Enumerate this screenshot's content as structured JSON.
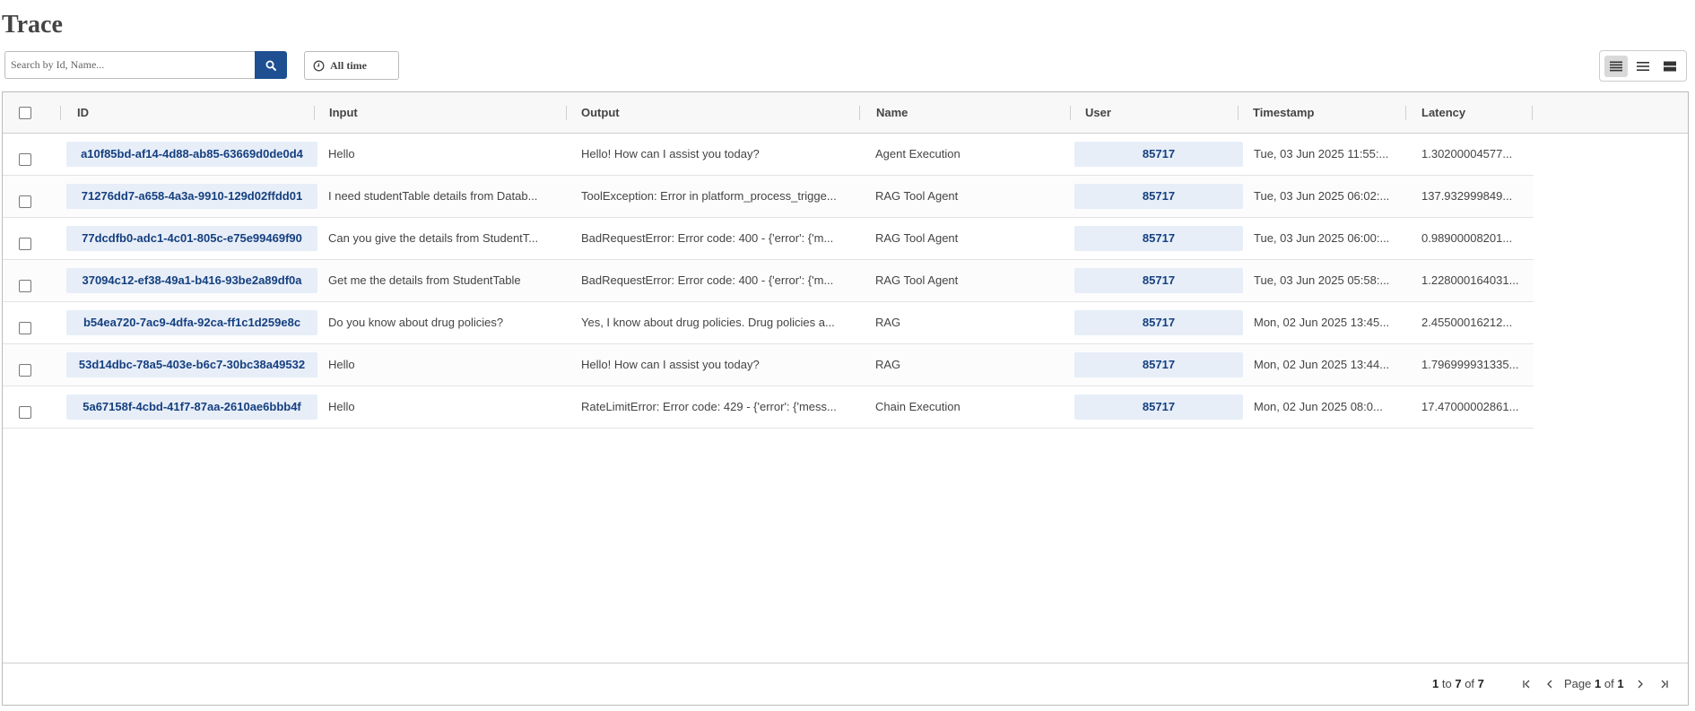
{
  "page": {
    "title": "Trace"
  },
  "search": {
    "placeholder": "Search by Id, Name...",
    "value": ""
  },
  "time_filter": {
    "label": "All time"
  },
  "columns": {
    "id": "ID",
    "input": "Input",
    "output": "Output",
    "name": "Name",
    "user": "User",
    "timestamp": "Timestamp",
    "latency": "Latency"
  },
  "rows": [
    {
      "id": "a10f85bd-af14-4d88-ab85-63669d0de0d4",
      "input": "Hello",
      "output": "Hello! How can I assist you today?",
      "name": "Agent Execution",
      "user": "85717",
      "timestamp": "Tue, 03 Jun 2025 11:55:...",
      "latency": "1.30200004577..."
    },
    {
      "id": "71276dd7-a658-4a3a-9910-129d02ffdd01",
      "input": "I need studentTable details from Datab...",
      "output": "ToolException: Error in platform_process_trigge...",
      "name": "RAG Tool Agent",
      "user": "85717",
      "timestamp": "Tue, 03 Jun 2025 06:02:...",
      "latency": "137.932999849..."
    },
    {
      "id": "77dcdfb0-adc1-4c01-805c-e75e99469f90",
      "input": "Can you give the details from StudentT...",
      "output": "BadRequestError: Error code: 400 - {'error': {'m...",
      "name": "RAG Tool Agent",
      "user": "85717",
      "timestamp": "Tue, 03 Jun 2025 06:00:...",
      "latency": "0.98900008201..."
    },
    {
      "id": "37094c12-ef38-49a1-b416-93be2a89df0a",
      "input": "Get me the details from StudentTable",
      "output": "BadRequestError: Error code: 400 - {'error': {'m...",
      "name": "RAG Tool Agent",
      "user": "85717",
      "timestamp": "Tue, 03 Jun 2025 05:58:...",
      "latency": "1.228000164031..."
    },
    {
      "id": "b54ea720-7ac9-4dfa-92ca-ff1c1d259e8c",
      "input": "Do you know about drug policies?",
      "output": "Yes, I know about drug policies. Drug policies a...",
      "name": "RAG",
      "user": "85717",
      "timestamp": "Mon, 02 Jun 2025 13:45...",
      "latency": "2.45500016212..."
    },
    {
      "id": "53d14dbc-78a5-403e-b6c7-30bc38a49532",
      "input": "Hello",
      "output": "Hello! How can I assist you today?",
      "name": "RAG",
      "user": "85717",
      "timestamp": "Mon, 02 Jun 2025 13:44...",
      "latency": "1.796999931335..."
    },
    {
      "id": "5a67158f-4cbd-41f7-87aa-2610ae6bbb4f",
      "input": "Hello",
      "output": "RateLimitError: Error code: 429 - {'error': {'mess...",
      "name": "Chain Execution",
      "user": "85717",
      "timestamp": "Mon, 02 Jun 2025 08:0...",
      "latency": "17.47000002861..."
    }
  ],
  "pagination": {
    "from": "1",
    "to_word": "to",
    "to": "7",
    "of_word": "of",
    "total": "7",
    "page_word": "Page",
    "page": "1",
    "pages": "1"
  },
  "icons": {
    "search": "search-icon",
    "clock": "clock-icon",
    "density": [
      "density-compact-icon",
      "density-standard-icon",
      "density-comfortable-icon"
    ],
    "pagination": [
      "first-page-icon",
      "previous-page-icon",
      "next-page-icon",
      "last-page-icon"
    ]
  },
  "colors": {
    "accent": "#1d4f91",
    "chip_bg": "#e7eef8",
    "chip_text": "#153f7f"
  }
}
